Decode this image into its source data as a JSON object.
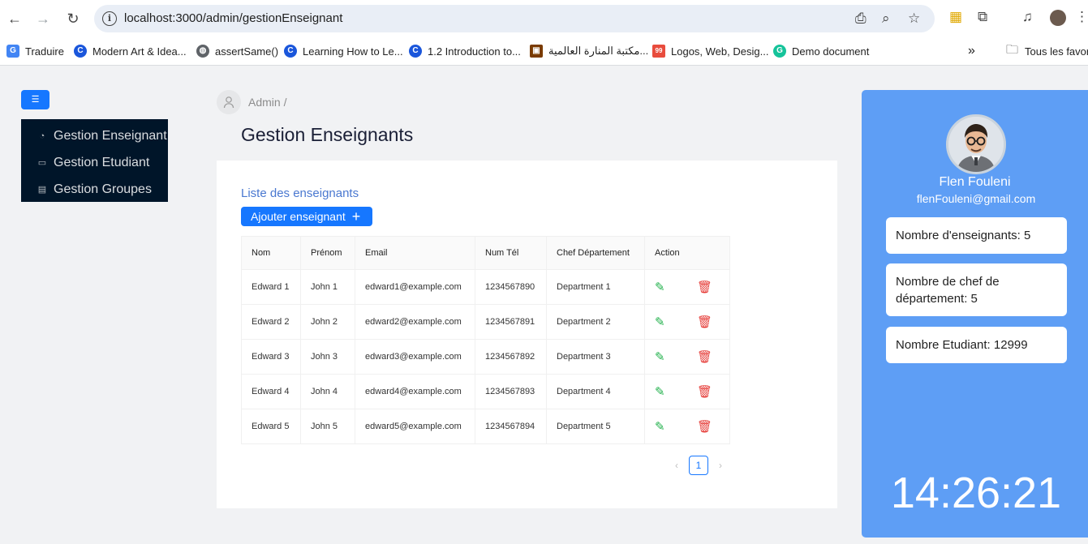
{
  "browser": {
    "url": "localhost:3000/admin/gestionEnseignant",
    "bookmarks": [
      {
        "label": "Traduire",
        "color": "#4285f4",
        "glyph": "G"
      },
      {
        "label": "Modern Art & Idea...",
        "color": "#1a56db",
        "glyph": "C"
      },
      {
        "label": "assertSame()",
        "color": "#5f6368",
        "glyph": "◍"
      },
      {
        "label": "Learning How to Le...",
        "color": "#1a56db",
        "glyph": "C"
      },
      {
        "label": "1.2 Introduction to...",
        "color": "#1a56db",
        "glyph": "C"
      },
      {
        "label": "مكتبة المنارة العالمية...",
        "color": "#7a3b00",
        "glyph": "▣"
      },
      {
        "label": "Logos, Web, Desig...",
        "color": "#e84c3d",
        "glyph": "99"
      },
      {
        "label": "Demo document",
        "color": "#15c39a",
        "glyph": "G"
      }
    ],
    "all_bookmarks": "Tous les favoris"
  },
  "sidebar": {
    "items": [
      {
        "label": "Gestion Enseignant",
        "icon": "pie-chart-icon"
      },
      {
        "label": "Gestion Etudiant",
        "icon": "desktop-icon"
      },
      {
        "label": "Gestion Groupes",
        "icon": "file-icon"
      }
    ]
  },
  "header": {
    "breadcrumb": "Admin /",
    "title": "Gestion Enseignants"
  },
  "main": {
    "list_title": "Liste des enseignants",
    "add_button": "Ajouter enseignant",
    "columns": [
      "Nom",
      "Prénom",
      "Email",
      "Num Tél",
      "Chef Département",
      "Action"
    ],
    "rows": [
      [
        "Edward 1",
        "John 1",
        "edward1@example.com",
        "1234567890",
        "Department 1"
      ],
      [
        "Edward 2",
        "John 2",
        "edward2@example.com",
        "1234567891",
        "Department 2"
      ],
      [
        "Edward 3",
        "John 3",
        "edward3@example.com",
        "1234567892",
        "Department 3"
      ],
      [
        "Edward 4",
        "John 4",
        "edward4@example.com",
        "1234567893",
        "Department 4"
      ],
      [
        "Edward 5",
        "John 5",
        "edward5@example.com",
        "1234567894",
        "Department 5"
      ]
    ],
    "pagination": {
      "current": "1"
    }
  },
  "profile": {
    "name": "Flen Fouleni",
    "email": "flenFouleni@gmail.com",
    "stats": [
      "Nombre d'enseignants: 5",
      "Nombre de chef de département: 5",
      "Nombre Etudiant: 12999"
    ],
    "clock": "14:26:21"
  },
  "colors": {
    "primary": "#1677ff",
    "sidebar_bg": "#001529",
    "panel_bg": "#5e9ef5",
    "edit": "#22b14c",
    "delete": "#e53935"
  }
}
